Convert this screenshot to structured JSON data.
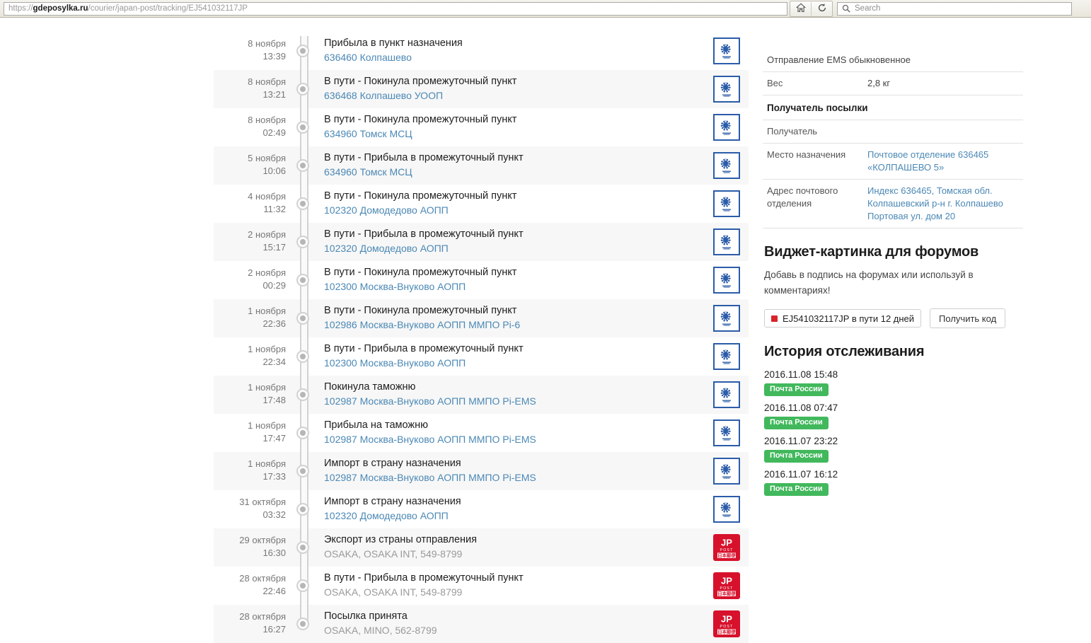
{
  "browser": {
    "url_prefix": "https://",
    "url_host": "gdeposylka.ru",
    "url_path": "/courier/japan-post/tracking/EJ541032117JP",
    "home_icon": "home-icon",
    "reload_icon": "reload-icon",
    "search_icon": "search-icon",
    "search_placeholder": "Search"
  },
  "tracking": {
    "events": [
      {
        "date": "8 ноября",
        "time": "13:39",
        "title": "Прибыла в пункт назначения",
        "place": "636460 Колпашево",
        "place_link": true,
        "carrier": "russian-post"
      },
      {
        "date": "8 ноября",
        "time": "13:21",
        "title": "В пути - Покинула промежуточный пункт",
        "place": "636468 Колпашево УООП",
        "place_link": true,
        "carrier": "russian-post"
      },
      {
        "date": "8 ноября",
        "time": "02:49",
        "title": "В пути - Покинула промежуточный пункт",
        "place": "634960 Томск МСЦ",
        "place_link": true,
        "carrier": "russian-post"
      },
      {
        "date": "5 ноября",
        "time": "10:06",
        "title": "В пути - Прибыла в промежуточный пункт",
        "place": "634960 Томск МСЦ",
        "place_link": true,
        "carrier": "russian-post"
      },
      {
        "date": "4 ноября",
        "time": "11:32",
        "title": "В пути - Покинула промежуточный пункт",
        "place": "102320 Домодедово АОПП",
        "place_link": true,
        "carrier": "russian-post"
      },
      {
        "date": "2 ноября",
        "time": "15:17",
        "title": "В пути - Прибыла в промежуточный пункт",
        "place": "102320 Домодедово АОПП",
        "place_link": true,
        "carrier": "russian-post"
      },
      {
        "date": "2 ноября",
        "time": "00:29",
        "title": "В пути - Покинула промежуточный пункт",
        "place": "102300 Москва-Внуково АОПП",
        "place_link": true,
        "carrier": "russian-post"
      },
      {
        "date": "1 ноября",
        "time": "22:36",
        "title": "В пути - Покинула промежуточный пункт",
        "place": "102986 Москва-Внуково АОПП ММПО Pi-6",
        "place_link": true,
        "carrier": "russian-post"
      },
      {
        "date": "1 ноября",
        "time": "22:34",
        "title": "В пути - Прибыла в промежуточный пункт",
        "place": "102300 Москва-Внуково АОПП",
        "place_link": true,
        "carrier": "russian-post"
      },
      {
        "date": "1 ноября",
        "time": "17:48",
        "title": "Покинула таможню",
        "place": "102987 Москва-Внуково АОПП ММПО Pi-EMS",
        "place_link": true,
        "carrier": "russian-post"
      },
      {
        "date": "1 ноября",
        "time": "17:47",
        "title": "Прибыла на таможню",
        "place": "102987 Москва-Внуково АОПП ММПО Pi-EMS",
        "place_link": true,
        "carrier": "russian-post"
      },
      {
        "date": "1 ноября",
        "time": "17:33",
        "title": "Импорт в страну назначения",
        "place": "102987 Москва-Внуково АОПП ММПО Pi-EMS",
        "place_link": true,
        "carrier": "russian-post"
      },
      {
        "date": "31 октября",
        "time": "03:32",
        "title": "Импорт в страну назначения",
        "place": "102320 Домодедово АОПП",
        "place_link": true,
        "carrier": "russian-post"
      },
      {
        "date": "29 октября",
        "time": "16:30",
        "title": "Экспорт из страны отправления",
        "place": "OSAKA, OSAKA INT, 549-8799",
        "place_link": false,
        "carrier": "japan-post"
      },
      {
        "date": "28 октября",
        "time": "22:46",
        "title": "В пути - Прибыла в промежуточный пункт",
        "place": "OSAKA, OSAKA INT, 549-8799",
        "place_link": false,
        "carrier": "japan-post"
      },
      {
        "date": "28 октября",
        "time": "16:27",
        "title": "Посылка принята",
        "place": "OSAKA, MINO, 562-8799",
        "place_link": false,
        "carrier": "japan-post"
      }
    ]
  },
  "sidebar": {
    "info_rows": [
      {
        "kind": "single",
        "key": "Отправление EMS обыкновенное"
      },
      {
        "kind": "pair",
        "key": "Вес",
        "value": "2,8 кг",
        "link": false
      },
      {
        "kind": "head",
        "key": "Получатель посылки"
      },
      {
        "kind": "pair",
        "key": "Получатель",
        "value": "",
        "link": false
      },
      {
        "kind": "pair",
        "key": "Место назначения",
        "value": "Почтовое отделение 636465 «КОЛПАШЕВО 5»",
        "link": true
      },
      {
        "kind": "pair",
        "key": "Адрес почтового отделения",
        "value": "Индекс 636465, Томская обл. Колпашевский р-н г. Колпашево Портовая ул. дом 20",
        "link": true
      }
    ],
    "widget": {
      "title": "Виджет-картинка для форумов",
      "subtitle": "Добавь в подпись на форумах или используй в комментариях!",
      "chip_label": "EJ541032117JP в пути 12 дней",
      "chip_icon": "red-square-icon",
      "button_label": "Получить код"
    },
    "history": {
      "title": "История отслеживания",
      "items": [
        {
          "time": "2016.11.08 15:48",
          "badge": "Почта России"
        },
        {
          "time": "2016.11.08 07:47",
          "badge": "Почта России"
        },
        {
          "time": "2016.11.07 23:22",
          "badge": "Почта России"
        },
        {
          "time": "2016.11.07 16:12",
          "badge": "Почта России"
        }
      ]
    }
  },
  "colors": {
    "link": "#4b88b5",
    "badge_green": "#41b85c",
    "japan_post_red": "#d7112c",
    "russian_post_blue": "#2b5ca8",
    "row_alt": "#f7f7f7"
  }
}
